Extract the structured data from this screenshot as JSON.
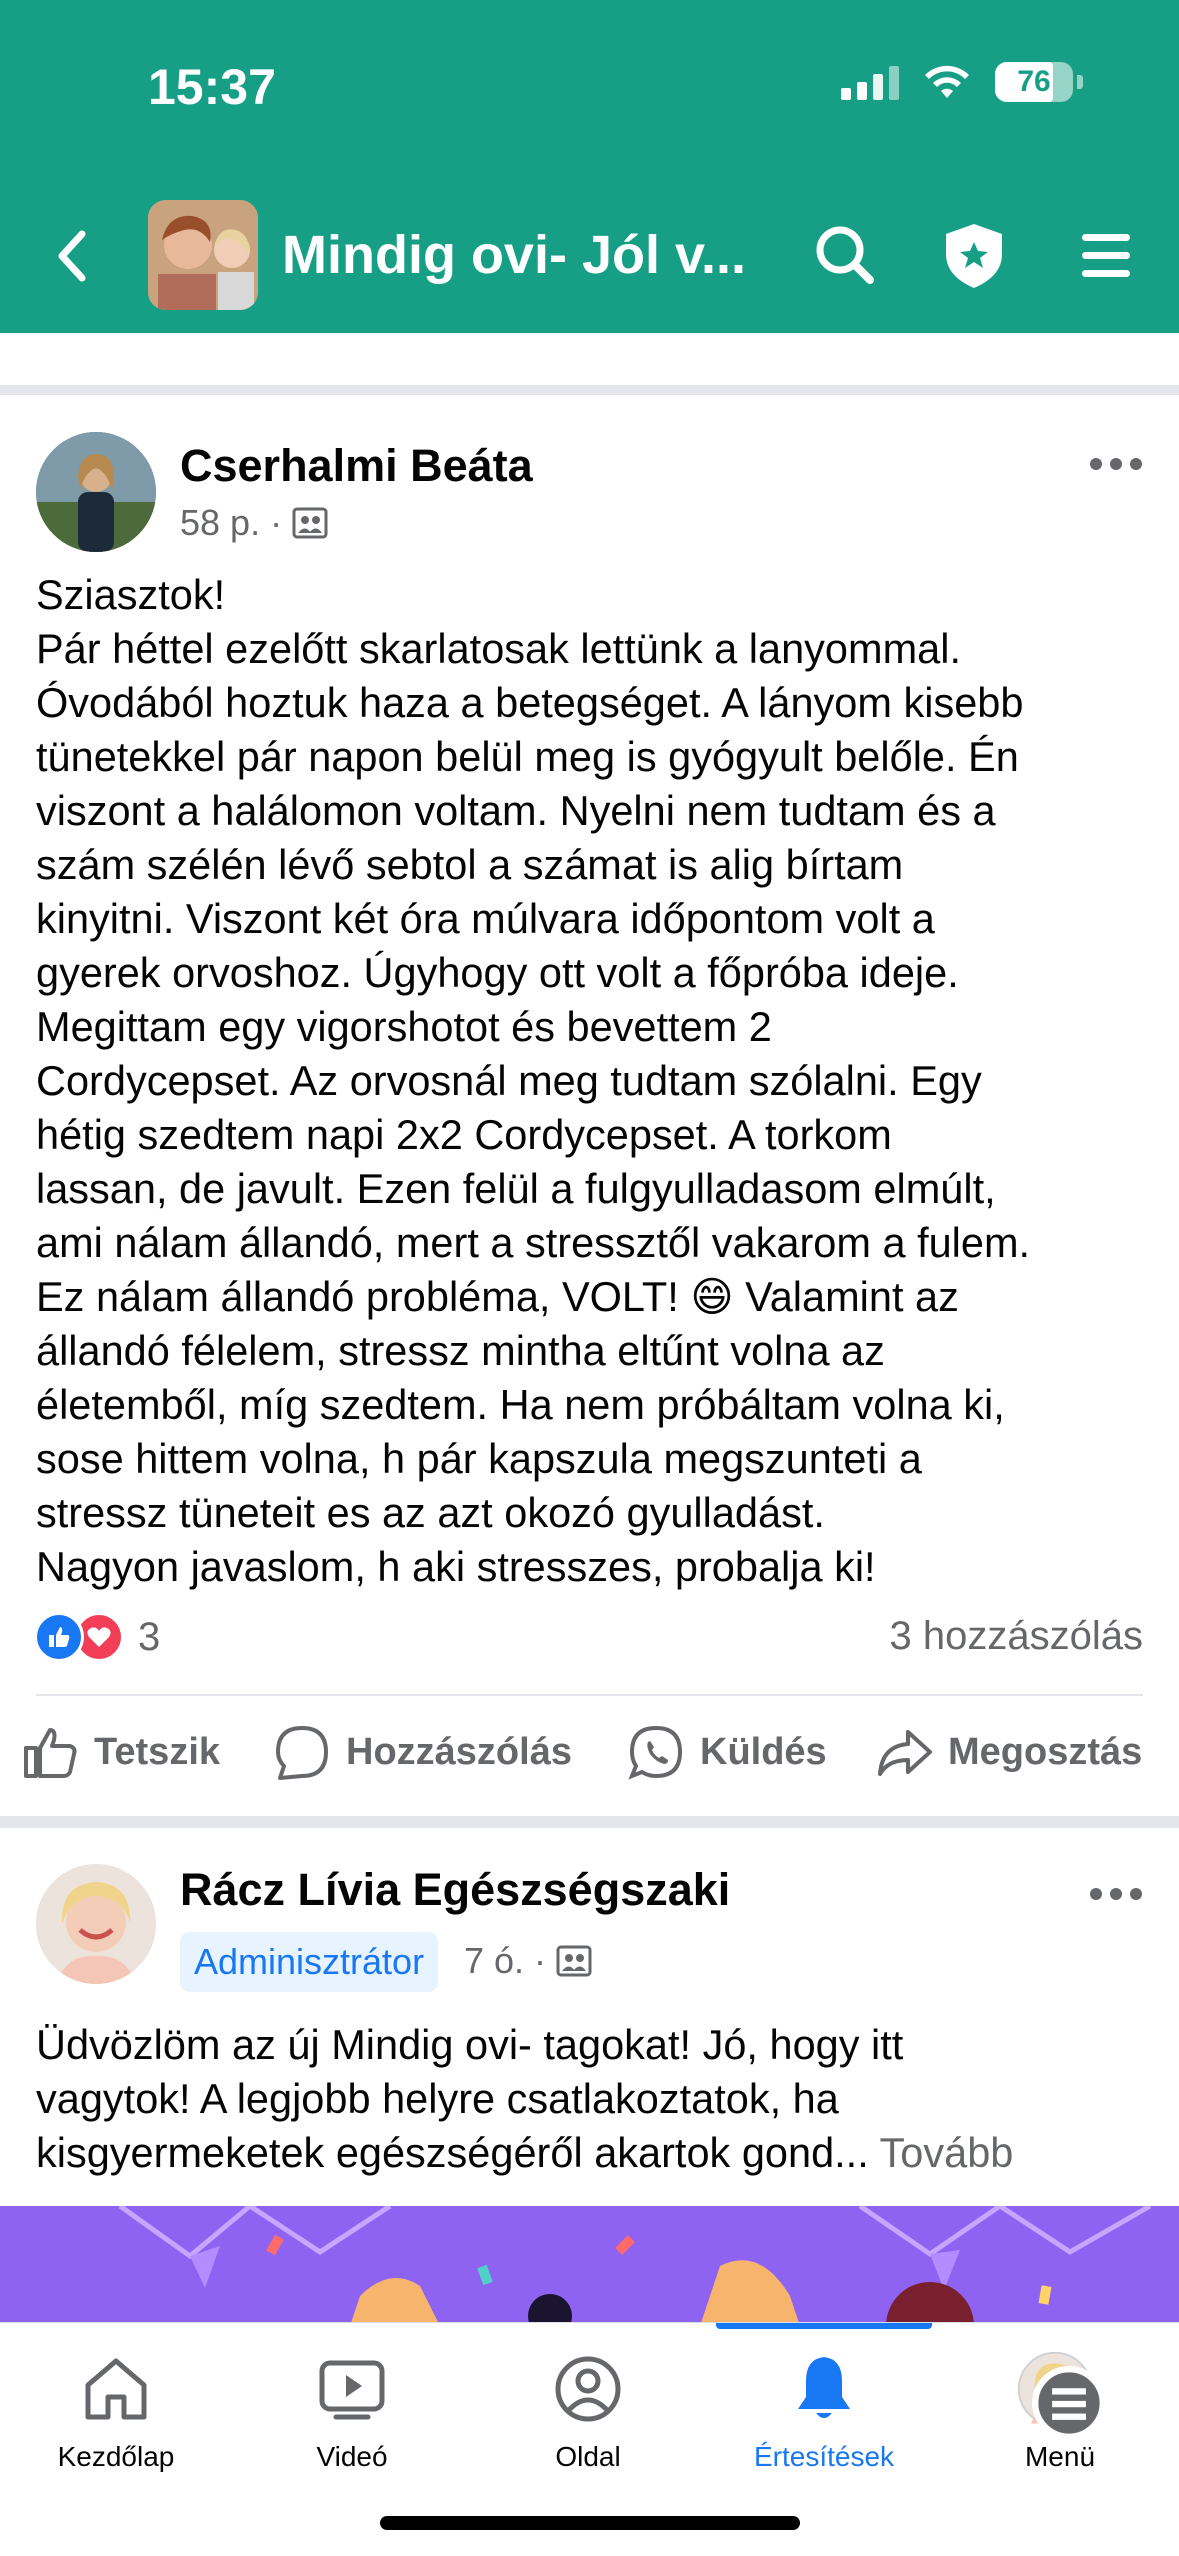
{
  "status_bar": {
    "time": "15:37",
    "battery": "76"
  },
  "header": {
    "group_title": "Mindig ovi- Jól v..."
  },
  "post1": {
    "author": "Cserhalmi Beáta",
    "time": "58 p.",
    "text_lines": [
      "Sziasztok!",
      "Pár héttel ezelőtt skarlatosak lettünk a lanyommal.",
      "Óvodából hoztuk haza a betegséget. A lányom kisebb",
      "tünetekkel pár napon belül meg is gyógyult belőle. Én",
      "viszont a halálomon voltam. Nyelni nem tudtam és a",
      "szám szélén lévő sebtol a számat is alig bírtam",
      "kinyitni. Viszont két óra múlvara időpontom volt a",
      "gyerek orvoshoz. Úgyhogy ott volt a főpróba ideje.",
      "Megittam egy vigorshotot és bevettem 2",
      "Cordycepset. Az orvosnál meg tudtam szólalni. Egy",
      "hétig szedtem napi 2x2 Cordycepset. A torkom",
      "lassan, de javult. Ezen felül a fulgyulladasom elmúlt,",
      "ami nálam állandó, mert a stressztől vakarom a fulem.",
      "Ez nálam állandó probléma, VOLT! 😄 Valamint az",
      "állandó félelem, stressz mintha eltűnt volna az",
      "életemből, míg szedtem. Ha nem próbáltam volna ki,",
      "sose hittem volna, h pár kapszula megszunteti a",
      "stressz tüneteit es az azt okozó gyulladást.",
      "Nagyon javaslom, h aki stresszes, probalja ki!"
    ],
    "reaction_count": "3",
    "comment_count": "3 hozzászólás"
  },
  "actions": {
    "like": "Tetszik",
    "comment": "Hozzászólás",
    "send": "Küldés",
    "share": "Megosztás"
  },
  "post2": {
    "author": "Rácz Lívia Egészségszaki",
    "badge": "Adminisztrátor",
    "time": "7 ó.",
    "text_lines": [
      "Üdvözlöm az új Mindig ovi- tagokat! Jó, hogy itt",
      "vagytok! A legjobb helyre csatlakoztatok, ha",
      "kisgyermeketek egészségéről akartok gond..."
    ],
    "more": "Tovább"
  },
  "tabs": [
    {
      "label": "Kezdőlap"
    },
    {
      "label": "Videó"
    },
    {
      "label": "Oldal"
    },
    {
      "label": "Értesítések"
    },
    {
      "label": "Menü"
    }
  ],
  "colors": {
    "header": "#179f86",
    "accent": "#1877f2",
    "secondary_text": "#65676b"
  }
}
